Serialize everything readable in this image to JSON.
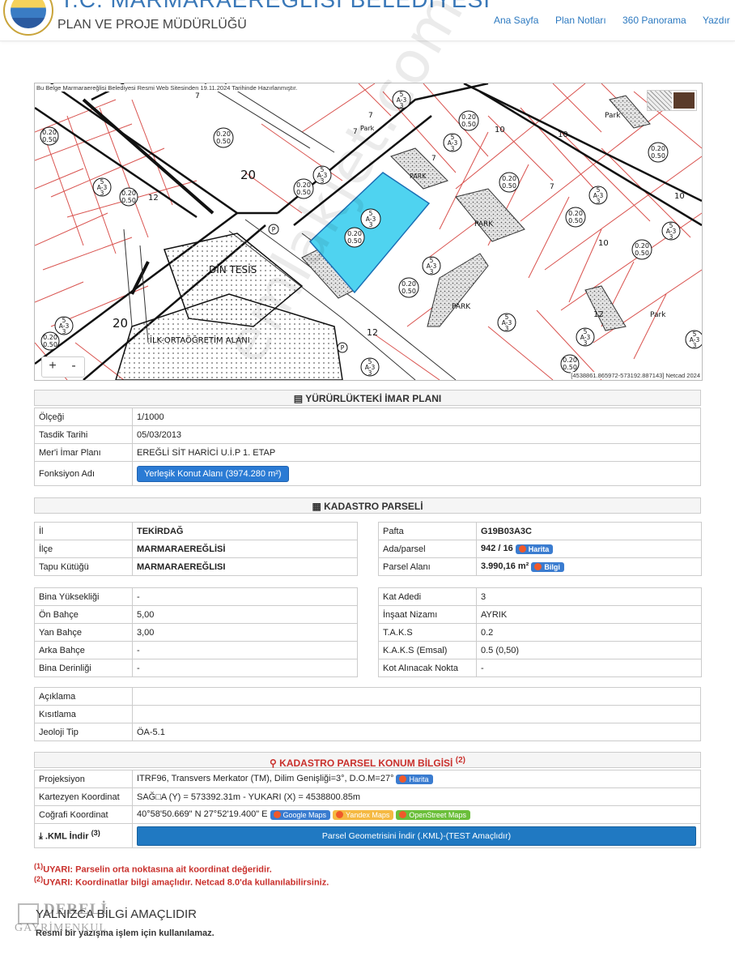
{
  "header": {
    "title_partial": "T.C. MARMARAEREĞLİSİ BELEDİYESİ",
    "subtitle": "PLAN VE PROJE MÜDÜRLÜĞÜ",
    "nav": [
      "Ana Sayfa",
      "Plan Notları",
      "360 Panorama",
      "Yazdır"
    ]
  },
  "map": {
    "note": "Bu Belge Marmaraereğlisi Belediyesi Resmi Web Sitesinden 19.11.2024 Tarihinde Hazırlanmıştır.",
    "coords": "[4538861.865972-573192.887143] Netcad 2024",
    "zoom_in": "+",
    "zoom_out": "-",
    "labels": {
      "din_tesis": "DİN TESİS",
      "school": "İLK-ORTAÖĞRETİM ALANI",
      "park": "PARK",
      "park_small": "Park",
      "ratio_a": "0.20",
      "ratio_b": "0.50",
      "a3": "A-3",
      "five": "5",
      "three": "3",
      "road20": "20",
      "road12": "12",
      "road10": "10",
      "road7": "7",
      "p": "P"
    }
  },
  "imar": {
    "title": "YÜRÜRLÜKTEKİ İMAR PLANI",
    "rows": [
      {
        "label": "Ölçeği",
        "value": "1/1000"
      },
      {
        "label": "Tasdik Tarihi",
        "value": "05/03/2013"
      },
      {
        "label": "Mer'i İmar Planı",
        "value": "EREĞLİ SİT HARİCİ U.İ.P 1. ETAP"
      }
    ],
    "fonksiyon_label": "Fonksiyon Adı",
    "fonksiyon_value": "Yerleşik Konut Alanı (3974.280 m²)"
  },
  "kadastro": {
    "title": "KADASTRO PARSELİ",
    "left": [
      {
        "label": "İl",
        "value": "TEKİRDAĞ"
      },
      {
        "label": "İlçe",
        "value": "MARMARAEREĞLİSİ"
      },
      {
        "label": "Tapu Kütüğü",
        "value": "MARMARAEREĞLISI"
      }
    ],
    "right": [
      {
        "label": "Pafta",
        "value": "G19B03A3C",
        "badge": ""
      },
      {
        "label": "Ada/parsel",
        "value": "942 / 16",
        "badge": "Harita"
      },
      {
        "label": "Parsel Alanı",
        "value": "3.990,16 m²",
        "badge": "Bilgi"
      }
    ],
    "left2": [
      {
        "label": "Bina Yüksekliği",
        "value": "-"
      },
      {
        "label": "Ön Bahçe",
        "value": "5,00"
      },
      {
        "label": "Yan Bahçe",
        "value": "3,00"
      },
      {
        "label": "Arka Bahçe",
        "value": "-"
      },
      {
        "label": "Bina Derinliği",
        "value": "-"
      }
    ],
    "right2": [
      {
        "label": "Kat Adedi",
        "value": "3"
      },
      {
        "label": "İnşaat Nizamı",
        "value": "AYRIK"
      },
      {
        "label": "T.A.K.S",
        "value": "0.2"
      },
      {
        "label": "K.A.K.S (Emsal)",
        "value": "0.5 (0,50)"
      },
      {
        "label": "Kot Alınacak Nokta",
        "value": "-"
      }
    ],
    "extra": [
      {
        "label": "Açıklama",
        "value": ""
      },
      {
        "label": "Kısıtlama",
        "value": ""
      },
      {
        "label": "Jeoloji Tip",
        "value": "ÖA-5.1"
      }
    ]
  },
  "konum": {
    "title": "KADASTRO PARSEL KONUM BİLGİSİ",
    "title_sup": "(2)",
    "projeksiyon_label": "Projeksiyon",
    "projeksiyon_value": "ITRF96, Transvers Merkator (TM), Dilim Genişliği=3°, D.O.M=27°",
    "projeksiyon_badge": "Harita",
    "kartezyen_label": "Kartezyen Koordinat",
    "kartezyen_value": "SAĞ□A (Y) = 573392.31m - YUKARI (X) = 4538800.85m",
    "cografi_label": "Coğrafi Koordinat",
    "cografi_value": "40°58'50.669\" N 27°52'19.400\" E",
    "badges": [
      "Google Maps",
      "Yandex Maps",
      "OpenStreet Maps"
    ],
    "kml_label": ".KML İndir",
    "kml_sup": "(3)",
    "kml_button": "Parsel Geometrisini İndir (.KML)-(TEST Amaçlıdır)"
  },
  "warnings": [
    {
      "sup": "(1)",
      "text": "UYARI: Parselin orta noktasına ait koordinat değeridir."
    },
    {
      "sup": "(2)",
      "text": "UYARI: Koordinatlar bilgi amaçlıdır. Netcad 8.0'da kullanılabilirsiniz."
    }
  ],
  "footer": {
    "line1": "YALNIZCA BİLGİ AMAÇLIDIR",
    "line2": "Resmi bir yazışma işlem için kullanılamaz."
  },
  "watermarks": {
    "site": "emlakjet.com",
    "dereli_1": "DERELİ",
    "dereli_2": "GAYRİMENKUL"
  },
  "colors": {
    "parcel_fill": "#4fd3f0",
    "parcel_stroke": "#1a6fb5",
    "road_line": "#111111",
    "lot_line": "#d9534f",
    "nav_link": "#2c79c0",
    "warning": "#c9302c",
    "button": "#2b7bd4"
  }
}
